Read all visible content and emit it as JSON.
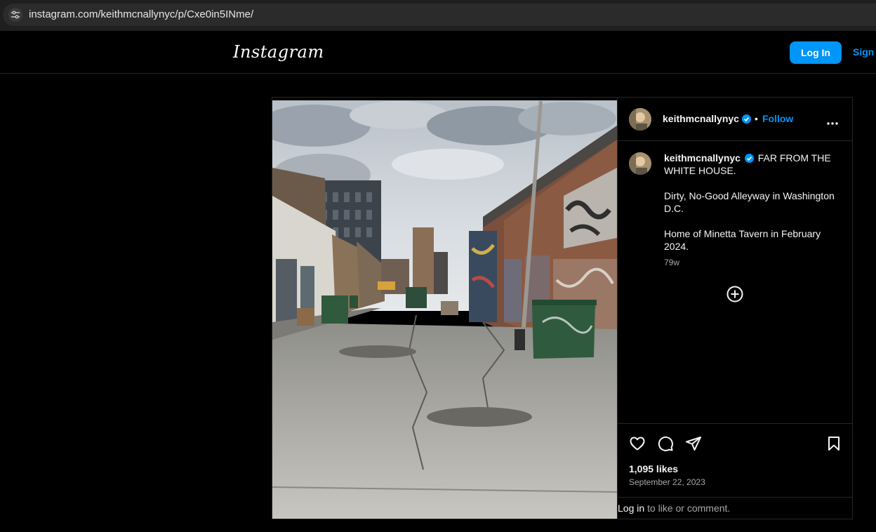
{
  "browser": {
    "url": "instagram.com/keithmcnallynyc/p/Cxe0in5INme/",
    "site_info_icon": "tune-icon"
  },
  "header": {
    "logo": "Instagram",
    "login_label": "Log In",
    "signup_label": "Sign"
  },
  "post": {
    "image_icon": "photo-alley",
    "username": "keithmcnallynyc",
    "verified": true,
    "follow_label": "Follow",
    "separator": "•",
    "more_icon": "more-horizontal-icon",
    "caption": {
      "username": "keithmcnallynyc",
      "line1": "FAR FROM THE WHITE HOUSE.",
      "line2": "Dirty, No-Good Alleyway in Washington D.C.",
      "line3": "Home of Minetta Tavern in February 2024."
    },
    "time_ago": "79w",
    "load_more_icon": "plus-circle-icon",
    "actions": {
      "like_icon": "heart-icon",
      "comment_icon": "comment-icon",
      "share_icon": "send-icon",
      "save_icon": "bookmark-icon"
    },
    "likes": "1,095 likes",
    "date": "September 22, 2023",
    "login_prompt": {
      "link": "Log in",
      "text": " to like or comment."
    }
  },
  "colors": {
    "accent": "#0095f6",
    "background": "#000000",
    "border": "#262626",
    "muted_text": "#a8a8a8"
  }
}
